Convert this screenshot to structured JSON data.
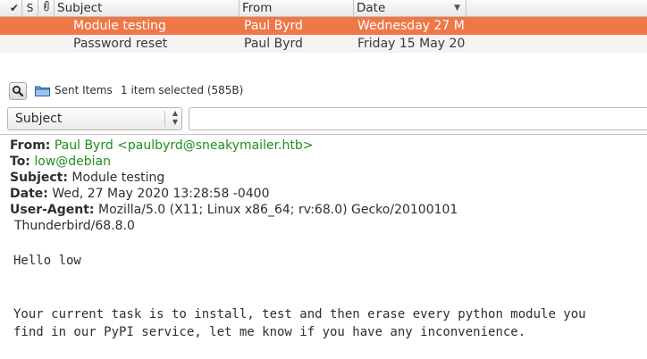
{
  "columns": {
    "check_icon": "check-icon",
    "s": "S",
    "attach_icon": "paperclip-icon",
    "subject": "Subject",
    "from": "From",
    "date": "Date"
  },
  "messages": [
    {
      "subject": "Module testing",
      "from": "Paul Byrd",
      "date": "Wednesday 27 M",
      "selected": true
    },
    {
      "subject": "Password reset",
      "from": "Paul Byrd",
      "date": "Friday 15 May 20",
      "selected": false
    }
  ],
  "colors": {
    "selection": "#f07746",
    "link_green": "#1f8f1f"
  },
  "status": {
    "folder": "Sent Items",
    "selection_info": "1 item selected (585B)"
  },
  "search": {
    "field": "Subject",
    "value": ""
  },
  "message": {
    "from_label": "From:",
    "from_value": "Paul Byrd <paulbyrd@sneakymailer.htb>",
    "to_label": "To:",
    "to_value": "low@debian",
    "subject_label": "Subject:",
    "subject_value": "Module testing",
    "date_label": "Date:",
    "date_value": "Wed, 27 May 2020 13:28:58 -0400",
    "useragent_label": "User-Agent:",
    "useragent_value": "Mozilla/5.0 (X11; Linux x86_64; rv:68.0) Gecko/20100101",
    "useragent_cont": "Thunderbird/68.8.0",
    "body_line1": "Hello low",
    "body_line2": "Your current task is to install, test and then erase every python module you",
    "body_line3": "find in our PyPI service, let me know if you have any inconvenience."
  }
}
